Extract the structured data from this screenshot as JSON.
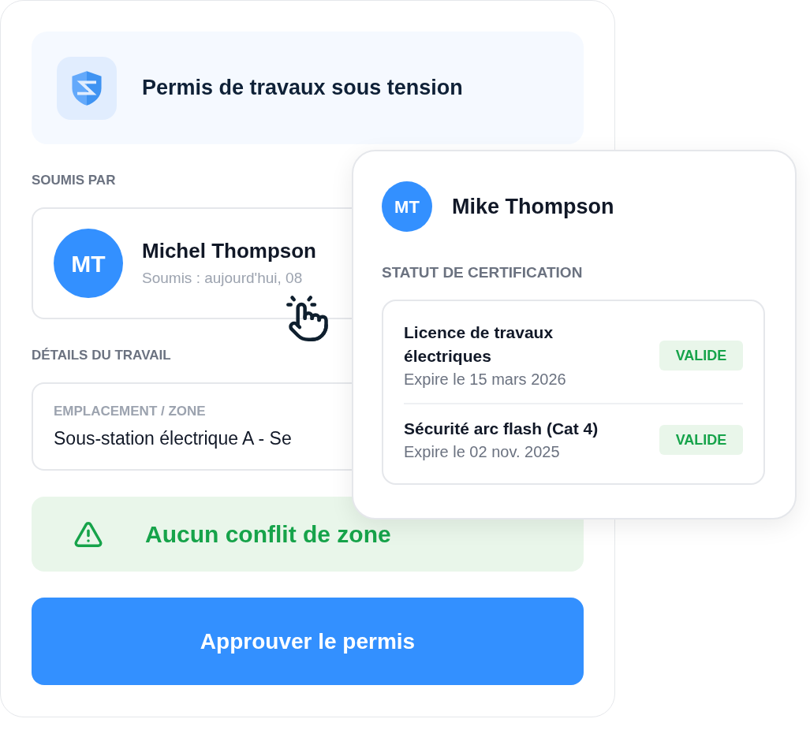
{
  "header": {
    "title": "Permis de travaux sous tension"
  },
  "submitted_by": {
    "label": "SOUMIS PAR",
    "avatar_initials": "MT",
    "name": "Michel Thompson",
    "submitted": "Soumis : aujourd'hui, 08"
  },
  "job_details": {
    "label": "DÉTAILS DU TRAVAIL",
    "location": {
      "label": "EMPLACEMENT / ZONE",
      "value": "Sous-station électrique A - Se"
    }
  },
  "zone_status": {
    "text": "Aucun conflit de zone"
  },
  "approve_button": {
    "label": "Approuver le permis"
  },
  "profile_popup": {
    "avatar_initials": "MT",
    "name": "Mike Thompson",
    "section_label": "STATUT DE CERTIFICATION",
    "certifications": [
      {
        "title": "Licence de travaux électriques",
        "expiry": "Expire le 15 mars 2026",
        "status": "VALIDE"
      },
      {
        "title": "Sécurité arc flash (Cat 4)",
        "expiry": "Expire le 02 nov. 2025",
        "status": "VALIDE"
      }
    ]
  }
}
